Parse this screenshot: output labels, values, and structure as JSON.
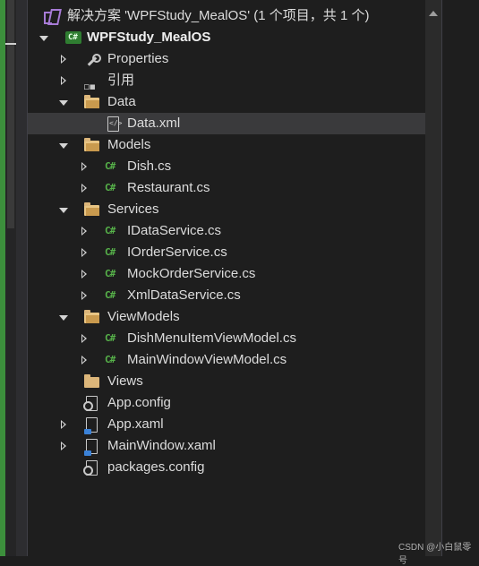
{
  "solution": {
    "label": "解决方案 'WPFStudy_MealOS' (1 个项目，共 1 个)"
  },
  "project": {
    "label": "WPFStudy_MealOS"
  },
  "tree": {
    "properties": "Properties",
    "references": "引用",
    "data_folder": "Data",
    "data_xml": "Data.xml",
    "models_folder": "Models",
    "dish_cs": "Dish.cs",
    "restaurant_cs": "Restaurant.cs",
    "services_folder": "Services",
    "idataservice_cs": "IDataService.cs",
    "iorderservice_cs": "IOrderService.cs",
    "mockorderservice_cs": "MockOrderService.cs",
    "xmldataservice_cs": "XmlDataService.cs",
    "viewmodels_folder": "ViewModels",
    "dishmenuitemviewmodel_cs": "DishMenuItemViewModel.cs",
    "mainwindowviewmodel_cs": "MainWindowViewModel.cs",
    "views_folder": "Views",
    "app_config": "App.config",
    "app_xaml": "App.xaml",
    "mainwindow_xaml": "MainWindow.xaml",
    "packages_config": "packages.config"
  },
  "icons": {
    "cs_glyph": "C#",
    "project_glyph": "C#",
    "xml_glyph": "</>",
    "config_glyph": "⚙",
    "references_glyph": "▫▪"
  },
  "watermark": "CSDN @小白鼠零号",
  "colors": {
    "background": "#1e1e1e",
    "selected_row": "#3a3a3c",
    "folder": "#dcb67a",
    "cs_icon": "#57b34a",
    "accent_strip": "#3c8f3c",
    "solution_icon": "#a77bd6"
  }
}
